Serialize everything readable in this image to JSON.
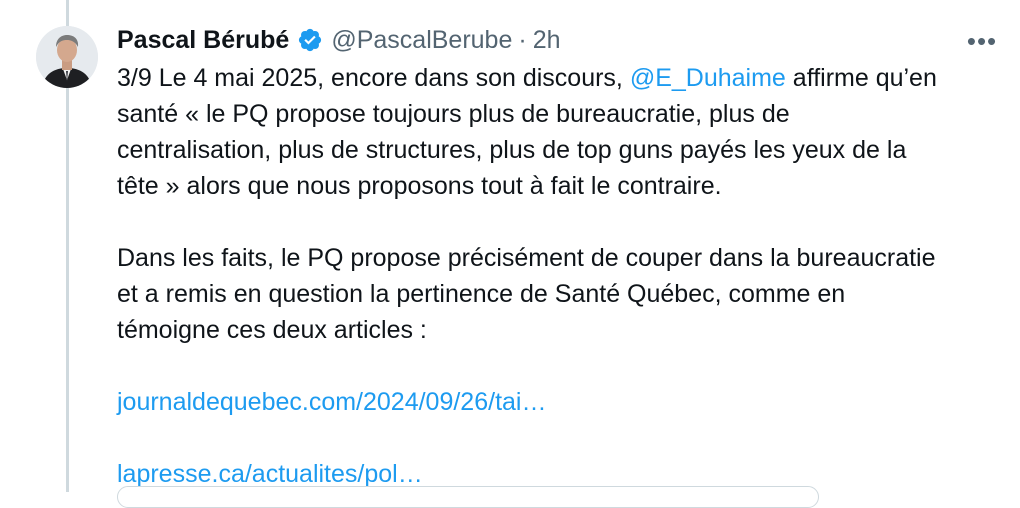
{
  "tweet": {
    "author_name": "Pascal Bérubé",
    "handle": "@PascalBerube",
    "separator": "·",
    "time": "2h",
    "more_label": "•••",
    "line1_prefix": "3/9 Le 4 mai 2025, encore dans son discours, ",
    "mention": "@E_Duhaime",
    "line1_suffix": " affirme qu’en",
    "line2": "santé « le PQ propose toujours plus de bureaucratie, plus de",
    "line3": "centralisation, plus de structures, plus de top guns payés les yeux de la",
    "line4": "tête » alors que nous proposons tout à fait le contraire.",
    "para2_line1": "Dans les faits, le PQ propose précisément de couper dans la bureaucratie",
    "para2_line2": "et a remis en question la pertinence de Santé Québec, comme en",
    "para2_line3": "témoigne ces deux articles :",
    "link1": "journaldequebec.com/2024/09/26/tai…",
    "link2": "lapresse.ca/actualites/pol…"
  },
  "colors": {
    "link": "#1d9bf0",
    "verified_badge": "#1d9bf0",
    "secondary_text": "#536471",
    "thread_line": "#cfd9de"
  },
  "icons": {
    "badge": "verified-badge-icon",
    "more": "more-options-icon"
  }
}
